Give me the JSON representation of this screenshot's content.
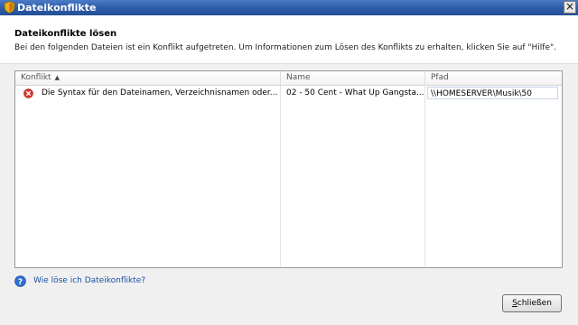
{
  "window": {
    "title": "Dateikonflikte",
    "close_glyph": "×"
  },
  "header": {
    "title": "Dateikonflikte lösen",
    "description": "Bei den folgenden Dateien ist ein Konflikt aufgetreten. Um Informationen zum Lösen des Konflikts zu erhalten, klicken Sie auf \"Hilfe\"."
  },
  "table": {
    "columns": [
      {
        "label": "Konflikt",
        "sort": "ascending",
        "sort_glyph": "▲"
      },
      {
        "label": "Name"
      },
      {
        "label": "Pfad"
      }
    ],
    "rows": [
      {
        "icon": "error-icon",
        "konflikt": "Die Syntax für den Dateinamen, Verzeichnisnamen oder...",
        "name": "02 - 50 Cent - What Up Gangsta...",
        "pfad": "\\\\HOMESERVER\\Musik\\50"
      }
    ]
  },
  "help": {
    "icon": "help-icon",
    "link": "Wie löse ich Dateikonflikte?"
  },
  "buttons": {
    "close_prefix": "S",
    "close_rest": "chließen"
  },
  "colors": {
    "titlebar": "#2f5da8",
    "link": "#1b4fa6",
    "error": "#d9342b"
  }
}
